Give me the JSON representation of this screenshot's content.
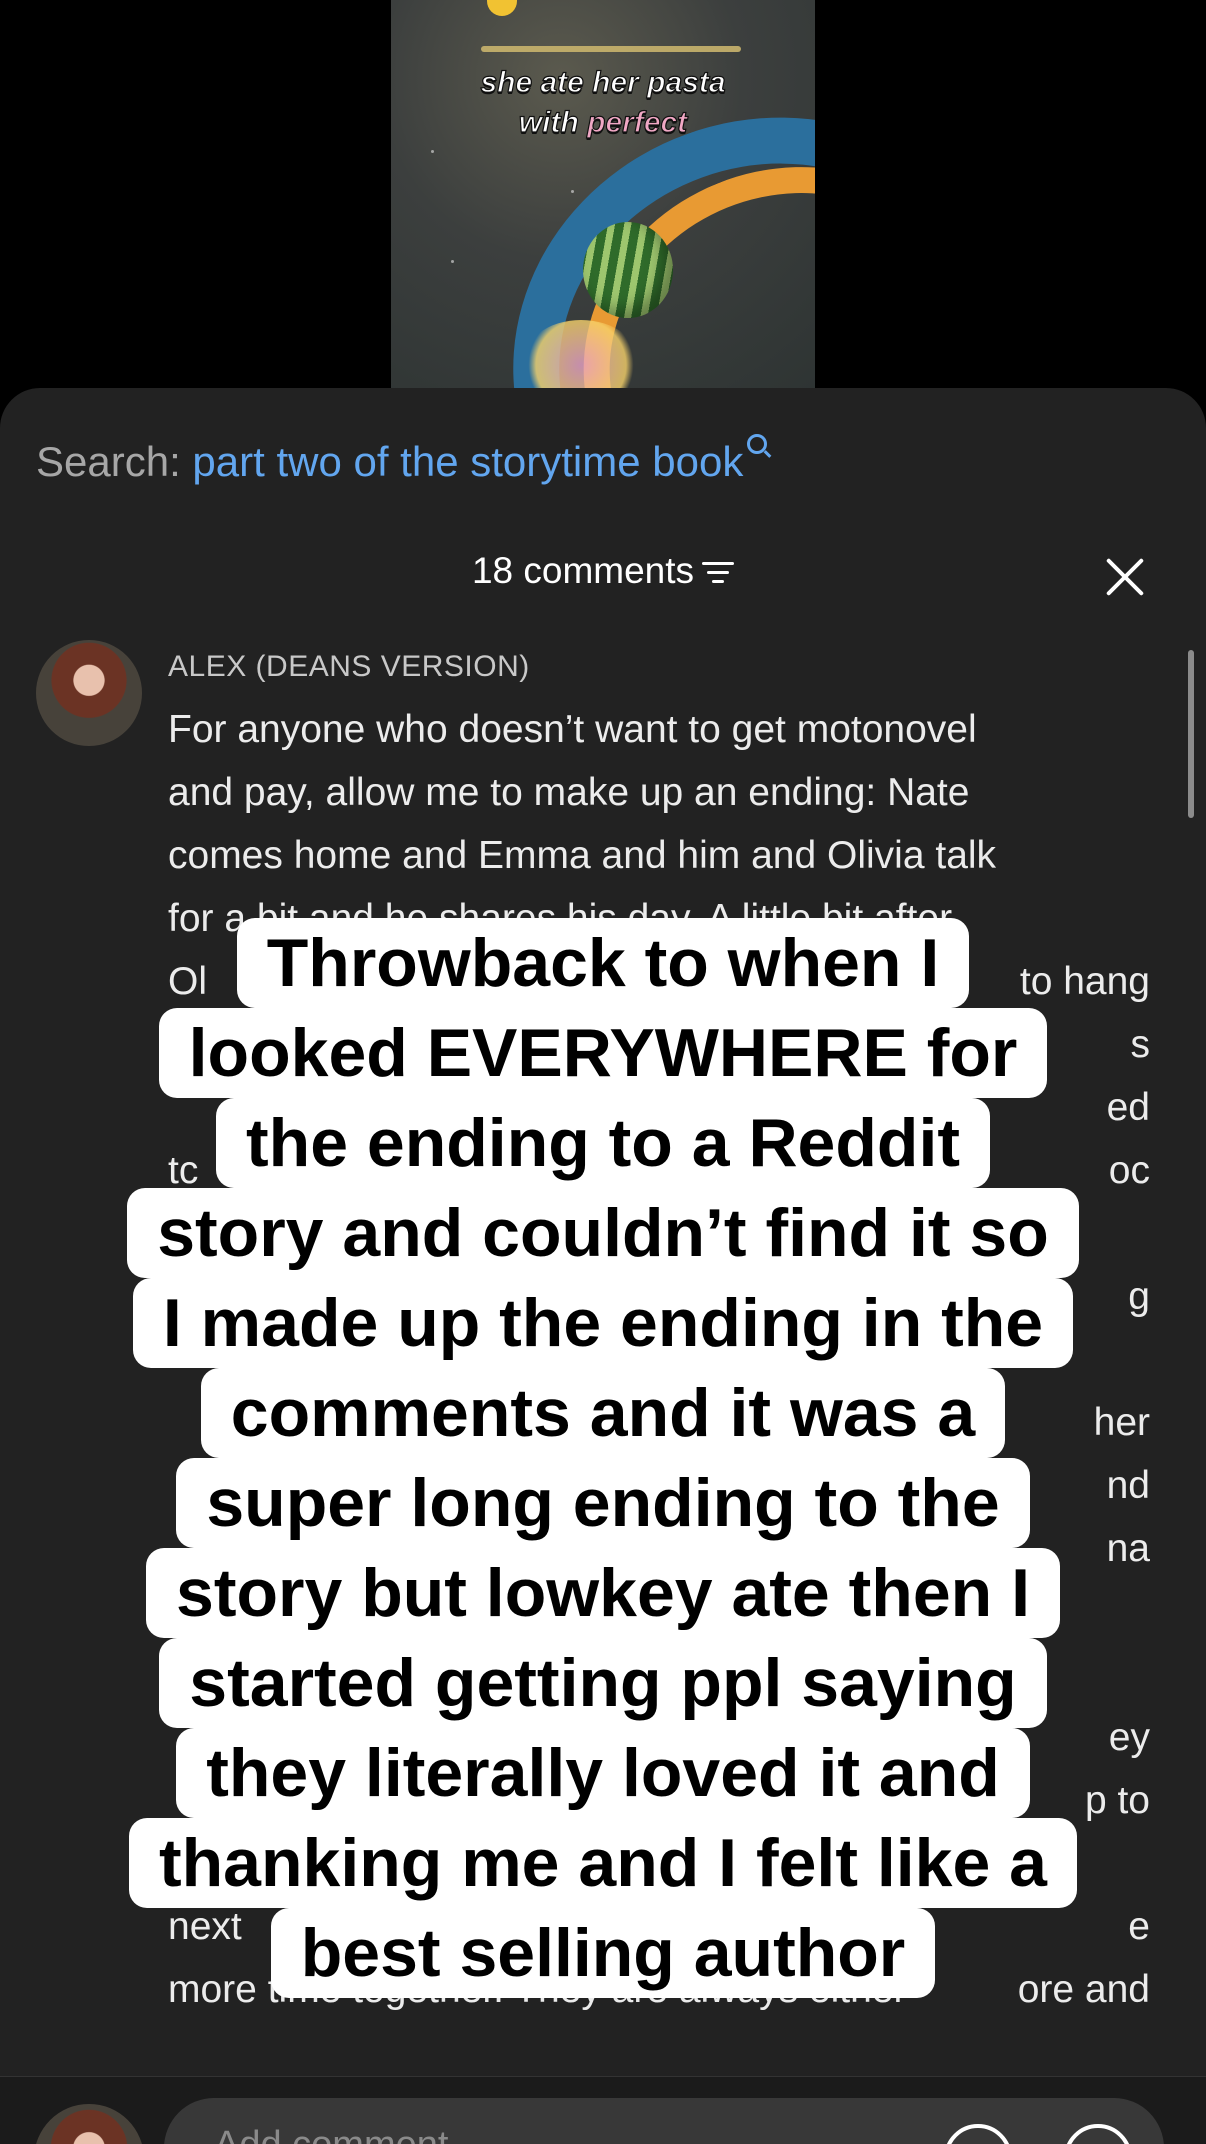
{
  "video": {
    "caption_line1": "she ate her pasta",
    "caption_line2_a": "with",
    "caption_line2_b": "perfect"
  },
  "search": {
    "label": "Search:",
    "query": "part two of the storytime book"
  },
  "comments_header": {
    "count_label": "18 comments"
  },
  "comment": {
    "author": "ALEX (DEANS VERSION)",
    "lines": [
      "For anyone who doesn’t want to get motonovel",
      "and pay, allow me to make up an ending: Nate",
      "comes home and Emma and him and Olivia talk",
      "for a bit and he shares his day. A little bit after,",
      "Ol",
      "",
      "",
      "tc",
      "",
      "",
      "",
      "",
      "",
      "",
      "",
      "",
      "",
      "",
      "",
      "next",
      "more time together. They are always either"
    ],
    "right_fragments": [
      "",
      "",
      "",
      "",
      "to hang",
      "s",
      "ed",
      "oc",
      "",
      "g",
      "",
      "her",
      "nd",
      "na",
      "",
      "",
      "ey",
      "p to",
      "",
      "e",
      "ore and"
    ]
  },
  "bottom": {
    "add_comment_placeholder": "Add comment..."
  },
  "overlay": {
    "lines": [
      "Throwback to when I",
      "looked EVERYWHERE for",
      "the ending to a Reddit",
      "story and couldn’t find it so",
      "I made up the ending in the",
      "comments and it was a",
      "super long ending to the",
      "story but lowkey ate then I",
      "started getting ppl saying",
      "they literally loved it and",
      "thanking me and I felt like a",
      "best selling author"
    ]
  },
  "colors": {
    "sheet_bg": "#222222",
    "search_accent": "#62a6ef",
    "overlay_bg": "#ffffff"
  }
}
